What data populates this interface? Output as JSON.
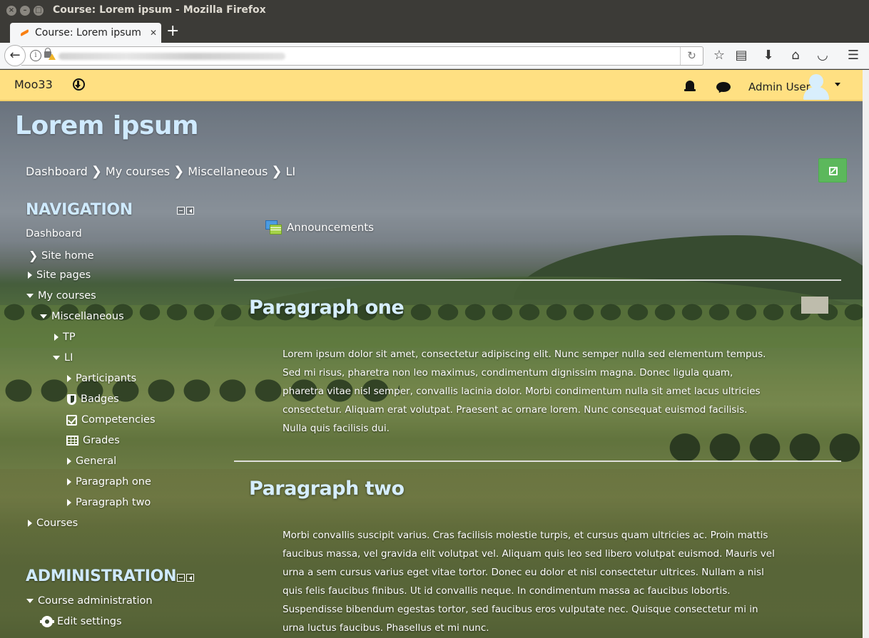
{
  "window": {
    "title": "Course: Lorem ipsum - Mozilla Firefox"
  },
  "browser": {
    "tab_title": "Course: Lorem ipsum",
    "tab_close": "✕",
    "new_tab": "+",
    "reload_glyph": "↻"
  },
  "header": {
    "site_name": "Moo33",
    "user_name": "Admin User"
  },
  "page": {
    "title": "Lorem ipsum",
    "breadcrumb": [
      "Dashboard",
      "My courses",
      "Miscellaneous",
      "LI"
    ],
    "crumb_sep": "❯"
  },
  "navigation": {
    "title": "NAVIGATION",
    "items": {
      "dashboard": "Dashboard",
      "site_home": "Site home",
      "site_pages": "Site pages",
      "my_courses": "My courses",
      "miscellaneous": "Miscellaneous",
      "tp": "TP",
      "li": "LI",
      "participants": "Participants",
      "badges": "Badges",
      "competencies": "Competencies",
      "grades": "Grades",
      "general": "General",
      "paragraph_one": "Paragraph one",
      "paragraph_two": "Paragraph two",
      "courses": "Courses"
    }
  },
  "administration": {
    "title": "ADMINISTRATION",
    "items": {
      "course_admin": "Course administration",
      "edit_settings": "Edit settings"
    }
  },
  "main": {
    "announcements": "Announcements",
    "sections": [
      {
        "title": "Paragraph one",
        "text": "Lorem ipsum dolor sit amet, consectetur adipiscing elit. Nunc semper nulla sed elementum tempus. Sed mi risus, pharetra non leo maximus, condimentum dignissim magna. Donec ligula quam, pharetra vitae nisl semper, convallis lacinia dolor. Morbi condimentum nulla sit amet lacus ultricies consectetur. Aliquam erat volutpat. Praesent ac ornare lorem. Nunc consequat euismod facilisis. Nulla quis facilisis dui."
      },
      {
        "title": "Paragraph two",
        "text": "Morbi convallis suscipit varius. Cras facilisis molestie turpis, et cursus quam ultricies ac. Proin mattis faucibus massa, vel gravida elit volutpat vel. Aliquam quis leo sed libero volutpat euismod. Mauris vel urna a sem cursus varius eget vitae tortor. Donec eu dolor et nisl consectetur ultrices. Nullam a nisl quis felis faucibus finibus. Ut id convallis neque. In condimentum massa ac faucibus lobortis. Suspendisse bibendum egestas tortor, sed faucibus eros vulputate nec. Quisque consectetur mi in urna luctus faucibus. Phasellus et mi nunc."
      }
    ]
  },
  "colors": {
    "header_bg": "#ffe082",
    "edit_button": "#5cb85c",
    "heading_text": "#cfeaff"
  }
}
